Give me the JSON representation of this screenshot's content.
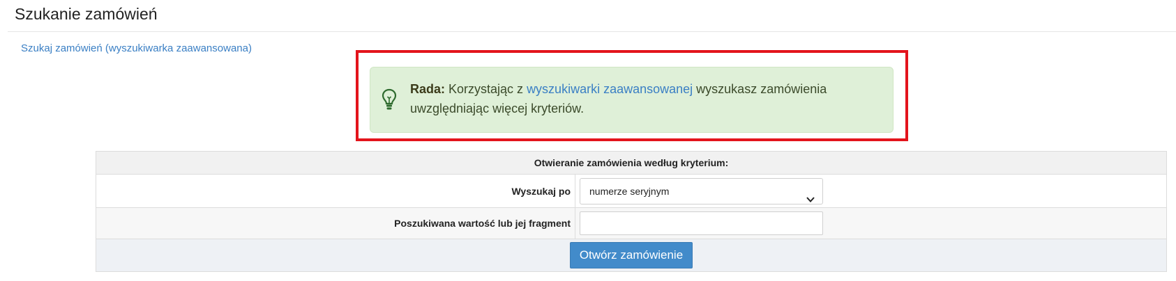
{
  "page": {
    "title": "Szukanie zamówień",
    "advanced_link": "Szukaj zamówień (wyszukiwarka zaawansowana)"
  },
  "tip": {
    "label": "Rada:",
    "text_before": " Korzystając z ",
    "link": "wyszukiwarki zaawansowanej",
    "text_after": " wyszukasz zamówienia uwzględniając więcej kryteriów.",
    "icon": "lightbulb-icon"
  },
  "form": {
    "header": "Otwieranie zamówienia według kryterium:",
    "search_by_label": "Wyszukaj po",
    "search_by_value": "numerze seryjnym",
    "value_label": "Poszukiwana wartość lub jej fragment",
    "value_input": "",
    "submit_label": "Otwórz zamówienie"
  },
  "colors": {
    "highlight": "#e3141c",
    "tip_background": "#dff0d8",
    "link": "#3a7fc4",
    "button": "#428bca"
  }
}
